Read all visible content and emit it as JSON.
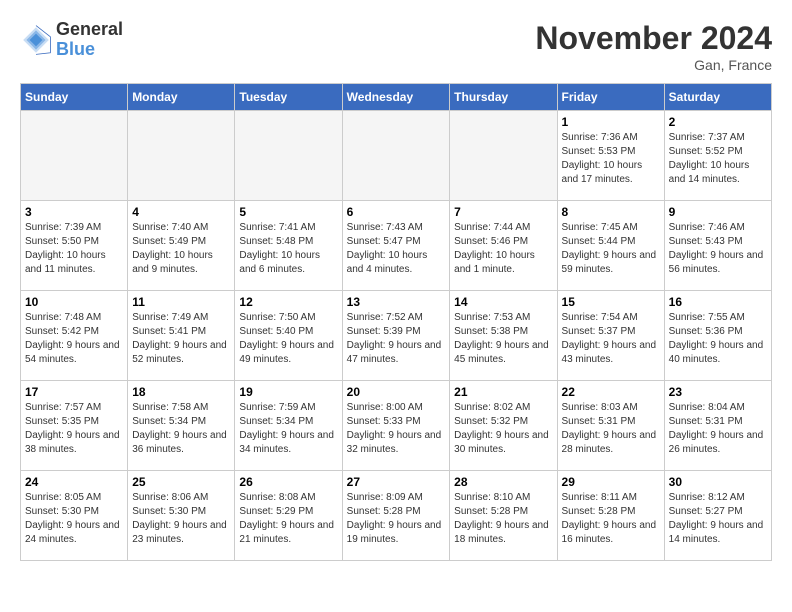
{
  "logo": {
    "general": "General",
    "blue": "Blue"
  },
  "title": "November 2024",
  "location": "Gan, France",
  "weekdays": [
    "Sunday",
    "Monday",
    "Tuesday",
    "Wednesday",
    "Thursday",
    "Friday",
    "Saturday"
  ],
  "weeks": [
    [
      {
        "day": "",
        "info": ""
      },
      {
        "day": "",
        "info": ""
      },
      {
        "day": "",
        "info": ""
      },
      {
        "day": "",
        "info": ""
      },
      {
        "day": "",
        "info": ""
      },
      {
        "day": "1",
        "info": "Sunrise: 7:36 AM\nSunset: 5:53 PM\nDaylight: 10 hours and 17 minutes."
      },
      {
        "day": "2",
        "info": "Sunrise: 7:37 AM\nSunset: 5:52 PM\nDaylight: 10 hours and 14 minutes."
      }
    ],
    [
      {
        "day": "3",
        "info": "Sunrise: 7:39 AM\nSunset: 5:50 PM\nDaylight: 10 hours and 11 minutes."
      },
      {
        "day": "4",
        "info": "Sunrise: 7:40 AM\nSunset: 5:49 PM\nDaylight: 10 hours and 9 minutes."
      },
      {
        "day": "5",
        "info": "Sunrise: 7:41 AM\nSunset: 5:48 PM\nDaylight: 10 hours and 6 minutes."
      },
      {
        "day": "6",
        "info": "Sunrise: 7:43 AM\nSunset: 5:47 PM\nDaylight: 10 hours and 4 minutes."
      },
      {
        "day": "7",
        "info": "Sunrise: 7:44 AM\nSunset: 5:46 PM\nDaylight: 10 hours and 1 minute."
      },
      {
        "day": "8",
        "info": "Sunrise: 7:45 AM\nSunset: 5:44 PM\nDaylight: 9 hours and 59 minutes."
      },
      {
        "day": "9",
        "info": "Sunrise: 7:46 AM\nSunset: 5:43 PM\nDaylight: 9 hours and 56 minutes."
      }
    ],
    [
      {
        "day": "10",
        "info": "Sunrise: 7:48 AM\nSunset: 5:42 PM\nDaylight: 9 hours and 54 minutes."
      },
      {
        "day": "11",
        "info": "Sunrise: 7:49 AM\nSunset: 5:41 PM\nDaylight: 9 hours and 52 minutes."
      },
      {
        "day": "12",
        "info": "Sunrise: 7:50 AM\nSunset: 5:40 PM\nDaylight: 9 hours and 49 minutes."
      },
      {
        "day": "13",
        "info": "Sunrise: 7:52 AM\nSunset: 5:39 PM\nDaylight: 9 hours and 47 minutes."
      },
      {
        "day": "14",
        "info": "Sunrise: 7:53 AM\nSunset: 5:38 PM\nDaylight: 9 hours and 45 minutes."
      },
      {
        "day": "15",
        "info": "Sunrise: 7:54 AM\nSunset: 5:37 PM\nDaylight: 9 hours and 43 minutes."
      },
      {
        "day": "16",
        "info": "Sunrise: 7:55 AM\nSunset: 5:36 PM\nDaylight: 9 hours and 40 minutes."
      }
    ],
    [
      {
        "day": "17",
        "info": "Sunrise: 7:57 AM\nSunset: 5:35 PM\nDaylight: 9 hours and 38 minutes."
      },
      {
        "day": "18",
        "info": "Sunrise: 7:58 AM\nSunset: 5:34 PM\nDaylight: 9 hours and 36 minutes."
      },
      {
        "day": "19",
        "info": "Sunrise: 7:59 AM\nSunset: 5:34 PM\nDaylight: 9 hours and 34 minutes."
      },
      {
        "day": "20",
        "info": "Sunrise: 8:00 AM\nSunset: 5:33 PM\nDaylight: 9 hours and 32 minutes."
      },
      {
        "day": "21",
        "info": "Sunrise: 8:02 AM\nSunset: 5:32 PM\nDaylight: 9 hours and 30 minutes."
      },
      {
        "day": "22",
        "info": "Sunrise: 8:03 AM\nSunset: 5:31 PM\nDaylight: 9 hours and 28 minutes."
      },
      {
        "day": "23",
        "info": "Sunrise: 8:04 AM\nSunset: 5:31 PM\nDaylight: 9 hours and 26 minutes."
      }
    ],
    [
      {
        "day": "24",
        "info": "Sunrise: 8:05 AM\nSunset: 5:30 PM\nDaylight: 9 hours and 24 minutes."
      },
      {
        "day": "25",
        "info": "Sunrise: 8:06 AM\nSunset: 5:30 PM\nDaylight: 9 hours and 23 minutes."
      },
      {
        "day": "26",
        "info": "Sunrise: 8:08 AM\nSunset: 5:29 PM\nDaylight: 9 hours and 21 minutes."
      },
      {
        "day": "27",
        "info": "Sunrise: 8:09 AM\nSunset: 5:28 PM\nDaylight: 9 hours and 19 minutes."
      },
      {
        "day": "28",
        "info": "Sunrise: 8:10 AM\nSunset: 5:28 PM\nDaylight: 9 hours and 18 minutes."
      },
      {
        "day": "29",
        "info": "Sunrise: 8:11 AM\nSunset: 5:28 PM\nDaylight: 9 hours and 16 minutes."
      },
      {
        "day": "30",
        "info": "Sunrise: 8:12 AM\nSunset: 5:27 PM\nDaylight: 9 hours and 14 minutes."
      }
    ]
  ]
}
